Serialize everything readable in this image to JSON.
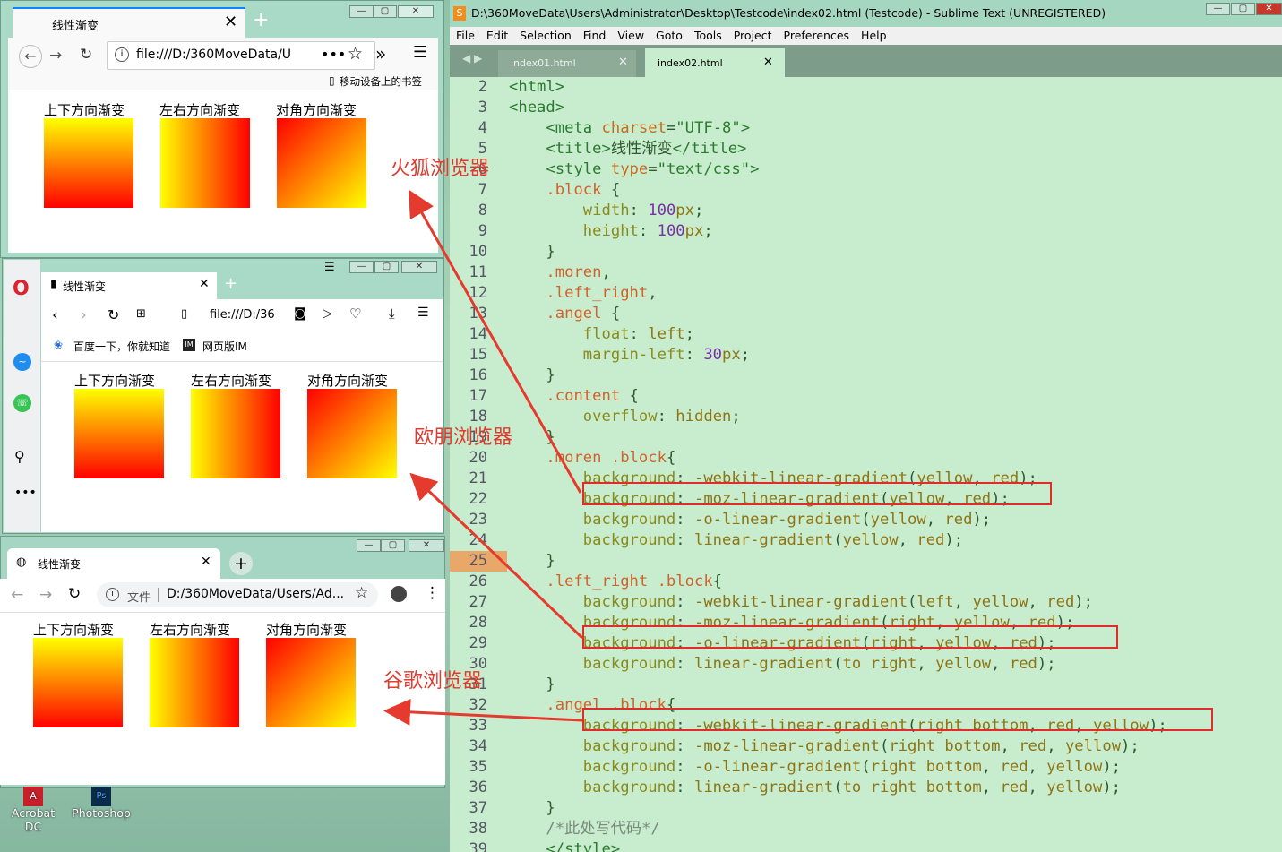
{
  "firefox": {
    "tab_title": "线性渐变",
    "url": "file:///D:/360MoveData/U",
    "bookmark_text": "移动设备上的书签"
  },
  "opera": {
    "tab_title": "线性渐变",
    "url": "file:///D:/36",
    "bookmarks": [
      "百度一下，你就知道",
      "网页版IM"
    ]
  },
  "chrome": {
    "tab_title": "线性渐变",
    "url_prefix": "文件",
    "url": "D:/360MoveData/Users/Ad..."
  },
  "demo_labels": [
    "上下方向渐变",
    "左右方向渐变",
    "对角方向渐变"
  ],
  "annotations": {
    "firefox": "火狐浏览器",
    "opera": "欧朋浏览器",
    "chrome": "谷歌浏览器"
  },
  "desktop_icons": [
    "Acrobat DC",
    "Photoshop"
  ],
  "editor": {
    "title": "D:\\360MoveData\\Users\\Administrator\\Desktop\\Testcode\\index02.html (Testcode) - Sublime Text (UNREGISTERED)",
    "menu": [
      "File",
      "Edit",
      "Selection",
      "Find",
      "View",
      "Goto",
      "Tools",
      "Project",
      "Preferences",
      "Help"
    ],
    "tabs": [
      "index01.html",
      "index02.html"
    ],
    "current_line": 25,
    "lines": [
      {
        "n": 2,
        "tokens": [
          [
            "t-tag",
            "<html>"
          ]
        ]
      },
      {
        "n": 3,
        "tokens": [
          [
            "t-tag",
            "<head>"
          ]
        ]
      },
      {
        "n": 4,
        "tokens": [
          [
            "t-plain",
            "    "
          ],
          [
            "t-tag",
            "<meta "
          ],
          [
            "t-attr",
            "charset"
          ],
          [
            "t-plain",
            "="
          ],
          [
            "t-str",
            "\"UTF-8\""
          ],
          [
            "t-tag",
            ">"
          ]
        ]
      },
      {
        "n": 5,
        "tokens": [
          [
            "t-plain",
            "    "
          ],
          [
            "t-tag",
            "<title>"
          ],
          [
            "t-plain",
            "线性渐变"
          ],
          [
            "t-tag",
            "</title>"
          ]
        ]
      },
      {
        "n": 6,
        "tokens": [
          [
            "t-plain",
            "    "
          ],
          [
            "t-tag",
            "<style "
          ],
          [
            "t-attr",
            "type"
          ],
          [
            "t-plain",
            "="
          ],
          [
            "t-str",
            "\"text/css\""
          ],
          [
            "t-tag",
            ">"
          ]
        ]
      },
      {
        "n": 7,
        "tokens": [
          [
            "t-plain",
            "    "
          ],
          [
            "t-sel",
            ".block"
          ],
          [
            "t-plain",
            " {"
          ]
        ]
      },
      {
        "n": 8,
        "tokens": [
          [
            "t-plain",
            "        "
          ],
          [
            "t-prop",
            "width"
          ],
          [
            "t-plain",
            ": "
          ],
          [
            "t-num",
            "100"
          ],
          [
            "t-val",
            "px"
          ],
          [
            "t-plain",
            ";"
          ]
        ]
      },
      {
        "n": 9,
        "tokens": [
          [
            "t-plain",
            "        "
          ],
          [
            "t-prop",
            "height"
          ],
          [
            "t-plain",
            ": "
          ],
          [
            "t-num",
            "100"
          ],
          [
            "t-val",
            "px"
          ],
          [
            "t-plain",
            ";"
          ]
        ]
      },
      {
        "n": 10,
        "tokens": [
          [
            "t-plain",
            "    }"
          ]
        ]
      },
      {
        "n": 11,
        "tokens": [
          [
            "t-plain",
            "    "
          ],
          [
            "t-sel",
            ".moren"
          ],
          [
            "t-plain",
            ","
          ]
        ]
      },
      {
        "n": 12,
        "tokens": [
          [
            "t-plain",
            "    "
          ],
          [
            "t-sel",
            ".left_right"
          ],
          [
            "t-plain",
            ","
          ]
        ]
      },
      {
        "n": 13,
        "tokens": [
          [
            "t-plain",
            "    "
          ],
          [
            "t-sel",
            ".angel"
          ],
          [
            "t-plain",
            " {"
          ]
        ]
      },
      {
        "n": 14,
        "tokens": [
          [
            "t-plain",
            "        "
          ],
          [
            "t-prop",
            "float"
          ],
          [
            "t-plain",
            ": "
          ],
          [
            "t-val",
            "left"
          ],
          [
            "t-plain",
            ";"
          ]
        ]
      },
      {
        "n": 15,
        "tokens": [
          [
            "t-plain",
            "        "
          ],
          [
            "t-prop",
            "margin-left"
          ],
          [
            "t-plain",
            ": "
          ],
          [
            "t-num",
            "30"
          ],
          [
            "t-val",
            "px"
          ],
          [
            "t-plain",
            ";"
          ]
        ]
      },
      {
        "n": 16,
        "tokens": [
          [
            "t-plain",
            "    }"
          ]
        ]
      },
      {
        "n": 17,
        "tokens": [
          [
            "t-plain",
            "    "
          ],
          [
            "t-sel",
            ".content"
          ],
          [
            "t-plain",
            " {"
          ]
        ]
      },
      {
        "n": 18,
        "tokens": [
          [
            "t-plain",
            "        "
          ],
          [
            "t-prop",
            "overflow"
          ],
          [
            "t-plain",
            ": "
          ],
          [
            "t-val",
            "hidden"
          ],
          [
            "t-plain",
            ";"
          ]
        ]
      },
      {
        "n": 19,
        "tokens": [
          [
            "t-plain",
            "    }"
          ]
        ]
      },
      {
        "n": 20,
        "tokens": [
          [
            "t-plain",
            "    "
          ],
          [
            "t-sel",
            ".moren .block"
          ],
          [
            "t-plain",
            "{"
          ]
        ]
      },
      {
        "n": 21,
        "tokens": [
          [
            "t-plain",
            "        "
          ],
          [
            "t-prop",
            "background"
          ],
          [
            "t-plain",
            ": "
          ],
          [
            "t-fn",
            "-webkit-linear-gradient"
          ],
          [
            "t-plain",
            "("
          ],
          [
            "t-val",
            "yellow"
          ],
          [
            "t-plain",
            ", "
          ],
          [
            "t-val",
            "red"
          ],
          [
            "t-plain",
            ");"
          ]
        ]
      },
      {
        "n": 22,
        "tokens": [
          [
            "t-plain",
            "        "
          ],
          [
            "t-prop",
            "background"
          ],
          [
            "t-plain",
            ": "
          ],
          [
            "t-fn",
            "-moz-linear-gradient"
          ],
          [
            "t-plain",
            "("
          ],
          [
            "t-val",
            "yellow"
          ],
          [
            "t-plain",
            ", "
          ],
          [
            "t-val",
            "red"
          ],
          [
            "t-plain",
            ");"
          ]
        ]
      },
      {
        "n": 23,
        "tokens": [
          [
            "t-plain",
            "        "
          ],
          [
            "t-prop",
            "background"
          ],
          [
            "t-plain",
            ": "
          ],
          [
            "t-fn",
            "-o-linear-gradient"
          ],
          [
            "t-plain",
            "("
          ],
          [
            "t-val",
            "yellow"
          ],
          [
            "t-plain",
            ", "
          ],
          [
            "t-val",
            "red"
          ],
          [
            "t-plain",
            ");"
          ]
        ]
      },
      {
        "n": 24,
        "tokens": [
          [
            "t-plain",
            "        "
          ],
          [
            "t-prop",
            "background"
          ],
          [
            "t-plain",
            ": "
          ],
          [
            "t-fn",
            "linear-gradient"
          ],
          [
            "t-plain",
            "("
          ],
          [
            "t-val",
            "yellow"
          ],
          [
            "t-plain",
            ", "
          ],
          [
            "t-val",
            "red"
          ],
          [
            "t-plain",
            ");"
          ]
        ]
      },
      {
        "n": 25,
        "tokens": [
          [
            "t-plain",
            "    }"
          ]
        ]
      },
      {
        "n": 26,
        "tokens": [
          [
            "t-plain",
            "    "
          ],
          [
            "t-sel",
            ".left_right .block"
          ],
          [
            "t-plain",
            "{"
          ]
        ]
      },
      {
        "n": 27,
        "tokens": [
          [
            "t-plain",
            "        "
          ],
          [
            "t-prop",
            "background"
          ],
          [
            "t-plain",
            ": "
          ],
          [
            "t-fn",
            "-webkit-linear-gradient"
          ],
          [
            "t-plain",
            "("
          ],
          [
            "t-val",
            "left"
          ],
          [
            "t-plain",
            ", "
          ],
          [
            "t-val",
            "yellow"
          ],
          [
            "t-plain",
            ", "
          ],
          [
            "t-val",
            "red"
          ],
          [
            "t-plain",
            ");"
          ]
        ]
      },
      {
        "n": 28,
        "tokens": [
          [
            "t-plain",
            "        "
          ],
          [
            "t-prop",
            "background"
          ],
          [
            "t-plain",
            ": "
          ],
          [
            "t-fn",
            "-moz-linear-gradient"
          ],
          [
            "t-plain",
            "("
          ],
          [
            "t-val",
            "right"
          ],
          [
            "t-plain",
            ", "
          ],
          [
            "t-val",
            "yellow"
          ],
          [
            "t-plain",
            ", "
          ],
          [
            "t-val",
            "red"
          ],
          [
            "t-plain",
            ");"
          ]
        ]
      },
      {
        "n": 29,
        "tokens": [
          [
            "t-plain",
            "        "
          ],
          [
            "t-prop",
            "background"
          ],
          [
            "t-plain",
            ": "
          ],
          [
            "t-fn",
            "-o-linear-gradient"
          ],
          [
            "t-plain",
            "("
          ],
          [
            "t-val",
            "right"
          ],
          [
            "t-plain",
            ", "
          ],
          [
            "t-val",
            "yellow"
          ],
          [
            "t-plain",
            ", "
          ],
          [
            "t-val",
            "red"
          ],
          [
            "t-plain",
            ");"
          ]
        ]
      },
      {
        "n": 30,
        "tokens": [
          [
            "t-plain",
            "        "
          ],
          [
            "t-prop",
            "background"
          ],
          [
            "t-plain",
            ": "
          ],
          [
            "t-fn",
            "linear-gradient"
          ],
          [
            "t-plain",
            "("
          ],
          [
            "t-val",
            "to right"
          ],
          [
            "t-plain",
            ", "
          ],
          [
            "t-val",
            "yellow"
          ],
          [
            "t-plain",
            ", "
          ],
          [
            "t-val",
            "red"
          ],
          [
            "t-plain",
            ");"
          ]
        ]
      },
      {
        "n": 31,
        "tokens": [
          [
            "t-plain",
            "    }"
          ]
        ]
      },
      {
        "n": 32,
        "tokens": [
          [
            "t-plain",
            "    "
          ],
          [
            "t-sel",
            ".angel .block"
          ],
          [
            "t-plain",
            "{"
          ]
        ]
      },
      {
        "n": 33,
        "tokens": [
          [
            "t-plain",
            "        "
          ],
          [
            "t-prop",
            "background"
          ],
          [
            "t-plain",
            ": "
          ],
          [
            "t-fn",
            "-webkit-linear-gradient"
          ],
          [
            "t-plain",
            "("
          ],
          [
            "t-val",
            "right bottom"
          ],
          [
            "t-plain",
            ", "
          ],
          [
            "t-val",
            "red"
          ],
          [
            "t-plain",
            ", "
          ],
          [
            "t-val",
            "yellow"
          ],
          [
            "t-plain",
            ");"
          ]
        ]
      },
      {
        "n": 34,
        "tokens": [
          [
            "t-plain",
            "        "
          ],
          [
            "t-prop",
            "background"
          ],
          [
            "t-plain",
            ": "
          ],
          [
            "t-fn",
            "-moz-linear-gradient"
          ],
          [
            "t-plain",
            "("
          ],
          [
            "t-val",
            "right bottom"
          ],
          [
            "t-plain",
            ", "
          ],
          [
            "t-val",
            "red"
          ],
          [
            "t-plain",
            ", "
          ],
          [
            "t-val",
            "yellow"
          ],
          [
            "t-plain",
            ");"
          ]
        ]
      },
      {
        "n": 35,
        "tokens": [
          [
            "t-plain",
            "        "
          ],
          [
            "t-prop",
            "background"
          ],
          [
            "t-plain",
            ": "
          ],
          [
            "t-fn",
            "-o-linear-gradient"
          ],
          [
            "t-plain",
            "("
          ],
          [
            "t-val",
            "right bottom"
          ],
          [
            "t-plain",
            ", "
          ],
          [
            "t-val",
            "red"
          ],
          [
            "t-plain",
            ", "
          ],
          [
            "t-val",
            "yellow"
          ],
          [
            "t-plain",
            ");"
          ]
        ]
      },
      {
        "n": 36,
        "tokens": [
          [
            "t-plain",
            "        "
          ],
          [
            "t-prop",
            "background"
          ],
          [
            "t-plain",
            ": "
          ],
          [
            "t-fn",
            "linear-gradient"
          ],
          [
            "t-plain",
            "("
          ],
          [
            "t-val",
            "to right bottom"
          ],
          [
            "t-plain",
            ", "
          ],
          [
            "t-val",
            "red"
          ],
          [
            "t-plain",
            ", "
          ],
          [
            "t-val",
            "yellow"
          ],
          [
            "t-plain",
            ");"
          ]
        ]
      },
      {
        "n": 37,
        "tokens": [
          [
            "t-plain",
            "    }"
          ]
        ]
      },
      {
        "n": 38,
        "tokens": [
          [
            "t-plain",
            "    "
          ],
          [
            "t-cmt",
            "/*此处写代码*/"
          ]
        ]
      },
      {
        "n": 39,
        "tokens": [
          [
            "t-plain",
            "    "
          ],
          [
            "t-tag",
            "</style>"
          ]
        ]
      }
    ]
  }
}
